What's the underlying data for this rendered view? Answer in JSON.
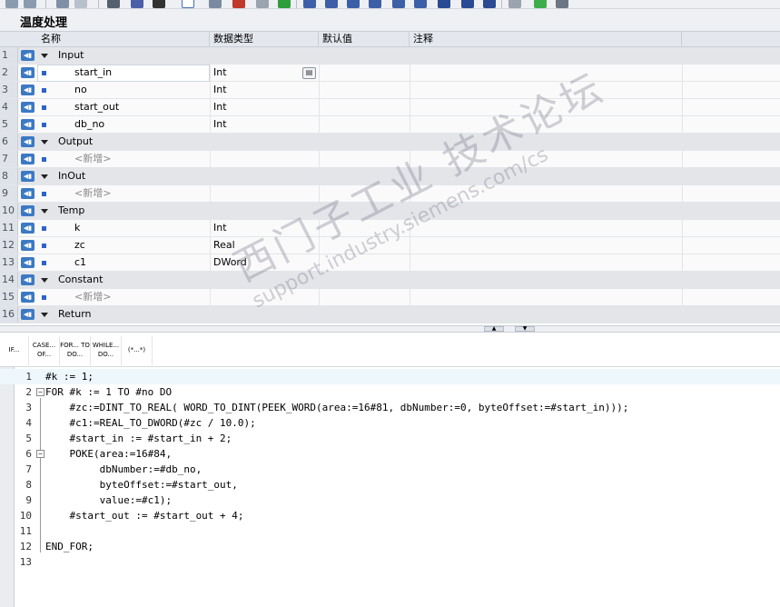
{
  "block_title": "温度处理",
  "interface": {
    "columns": [
      "名称",
      "数据类型",
      "默认值",
      "注释"
    ],
    "rows": [
      {
        "num": "1",
        "kind": "section",
        "name": "Input",
        "type": ""
      },
      {
        "num": "2",
        "kind": "item",
        "name": "start_in",
        "type": "Int",
        "selected": true
      },
      {
        "num": "3",
        "kind": "item",
        "name": "no",
        "type": "Int"
      },
      {
        "num": "4",
        "kind": "item",
        "name": "start_out",
        "type": "Int"
      },
      {
        "num": "5",
        "kind": "item",
        "name": "db_no",
        "type": "Int"
      },
      {
        "num": "6",
        "kind": "section",
        "name": "Output",
        "type": ""
      },
      {
        "num": "7",
        "kind": "placeholder",
        "name": "<新增>",
        "type": ""
      },
      {
        "num": "8",
        "kind": "section",
        "name": "InOut",
        "type": ""
      },
      {
        "num": "9",
        "kind": "placeholder",
        "name": "<新增>",
        "type": ""
      },
      {
        "num": "10",
        "kind": "section",
        "name": "Temp",
        "type": ""
      },
      {
        "num": "11",
        "kind": "item",
        "name": "k",
        "type": "Int"
      },
      {
        "num": "12",
        "kind": "item",
        "name": "zc",
        "type": "Real"
      },
      {
        "num": "13",
        "kind": "item",
        "name": "c1",
        "type": "DWord"
      },
      {
        "num": "14",
        "kind": "section",
        "name": "Constant",
        "type": ""
      },
      {
        "num": "15",
        "kind": "placeholder",
        "name": "<新增>",
        "type": ""
      },
      {
        "num": "16",
        "kind": "section",
        "name": "Return",
        "type": ""
      }
    ]
  },
  "palette": {
    "items": [
      "IF...",
      "CASE... OF...",
      "FOR... TO DO...",
      "WHILE... DO...",
      "(*...*)"
    ]
  },
  "code": {
    "lines": [
      {
        "num": "1",
        "text": "#k := 1;"
      },
      {
        "num": "2",
        "text": "FOR #k := 1 TO #no DO",
        "fold": "−"
      },
      {
        "num": "3",
        "text": "    #zc:=DINT_TO_REAL( WORD_TO_DINT(PEEK_WORD(area:=16#81, dbNumber:=0, byteOffset:=#start_in)));"
      },
      {
        "num": "4",
        "text": "    #c1:=REAL_TO_DWORD(#zc / 10.0);"
      },
      {
        "num": "5",
        "text": "    #start_in := #start_in + 2;"
      },
      {
        "num": "6",
        "text": "    POKE(area:=16#84,",
        "fold": "−"
      },
      {
        "num": "7",
        "text": "         dbNumber:=#db_no,"
      },
      {
        "num": "8",
        "text": "         byteOffset:=#start_out,"
      },
      {
        "num": "9",
        "text": "         value:=#c1);"
      },
      {
        "num": "10",
        "text": "    #start_out := #start_out + 4;"
      },
      {
        "num": "11",
        "text": ""
      },
      {
        "num": "12",
        "text": "END_FOR;"
      },
      {
        "num": "13",
        "text": ""
      }
    ]
  },
  "watermark": {
    "line1": "西门子工业  技术论坛",
    "line2": "support.industry.siemens.com/cs"
  },
  "colors": {
    "accent": "#3c79c4",
    "section_bg": "#e3e5e8",
    "header_bg": "#e4e8ee",
    "current_line": "#eef7fb"
  }
}
